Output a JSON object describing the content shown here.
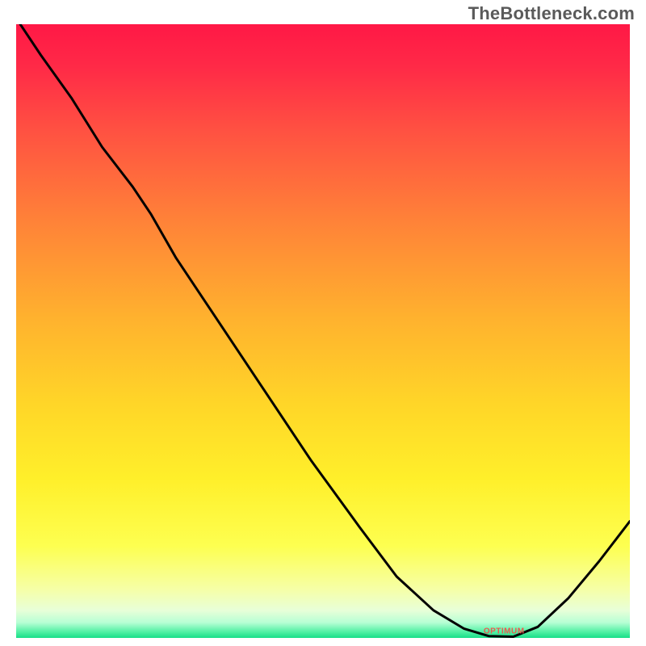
{
  "watermark": "TheBottleneck.com",
  "chart_data": {
    "type": "line",
    "title": "",
    "xlabel": "",
    "ylabel": "",
    "xlim": [
      0,
      100
    ],
    "ylim": [
      0,
      100
    ],
    "grid": false,
    "background": {
      "type": "vertical-gradient",
      "stops": [
        {
          "pos": 0.0,
          "color": "#ff1846"
        },
        {
          "pos": 0.07,
          "color": "#ff2a47"
        },
        {
          "pos": 0.17,
          "color": "#ff5042"
        },
        {
          "pos": 0.32,
          "color": "#ff8238"
        },
        {
          "pos": 0.48,
          "color": "#ffb22e"
        },
        {
          "pos": 0.62,
          "color": "#ffd628"
        },
        {
          "pos": 0.74,
          "color": "#ffef2a"
        },
        {
          "pos": 0.85,
          "color": "#fdff50"
        },
        {
          "pos": 0.92,
          "color": "#f6ffa6"
        },
        {
          "pos": 0.955,
          "color": "#e8ffd8"
        },
        {
          "pos": 0.975,
          "color": "#b7ffd5"
        },
        {
          "pos": 0.99,
          "color": "#52f0a4"
        },
        {
          "pos": 1.0,
          "color": "#18df88"
        }
      ]
    },
    "series": [
      {
        "name": "bottleneck-curve",
        "color": "#000000",
        "stroke_width": 3,
        "points": [
          {
            "x": 0,
            "y": 101
          },
          {
            "x": 4,
            "y": 95
          },
          {
            "x": 9,
            "y": 88
          },
          {
            "x": 14,
            "y": 80
          },
          {
            "x": 19,
            "y": 73.5
          },
          {
            "x": 22,
            "y": 69
          },
          {
            "x": 26,
            "y": 62
          },
          {
            "x": 32,
            "y": 53
          },
          {
            "x": 40,
            "y": 41
          },
          {
            "x": 48,
            "y": 29
          },
          {
            "x": 56,
            "y": 18
          },
          {
            "x": 62,
            "y": 10
          },
          {
            "x": 68,
            "y": 4.5
          },
          {
            "x": 73,
            "y": 1.5
          },
          {
            "x": 77,
            "y": 0.3
          },
          {
            "x": 81,
            "y": 0.2
          },
          {
            "x": 85,
            "y": 1.8
          },
          {
            "x": 90,
            "y": 6.5
          },
          {
            "x": 95,
            "y": 12.5
          },
          {
            "x": 100,
            "y": 19
          }
        ]
      }
    ],
    "annotations": [
      {
        "name": "minimum-marker",
        "text": "OPTIMUM",
        "x": 79.5,
        "y": 1.0,
        "color": "#e85a4f"
      }
    ]
  }
}
